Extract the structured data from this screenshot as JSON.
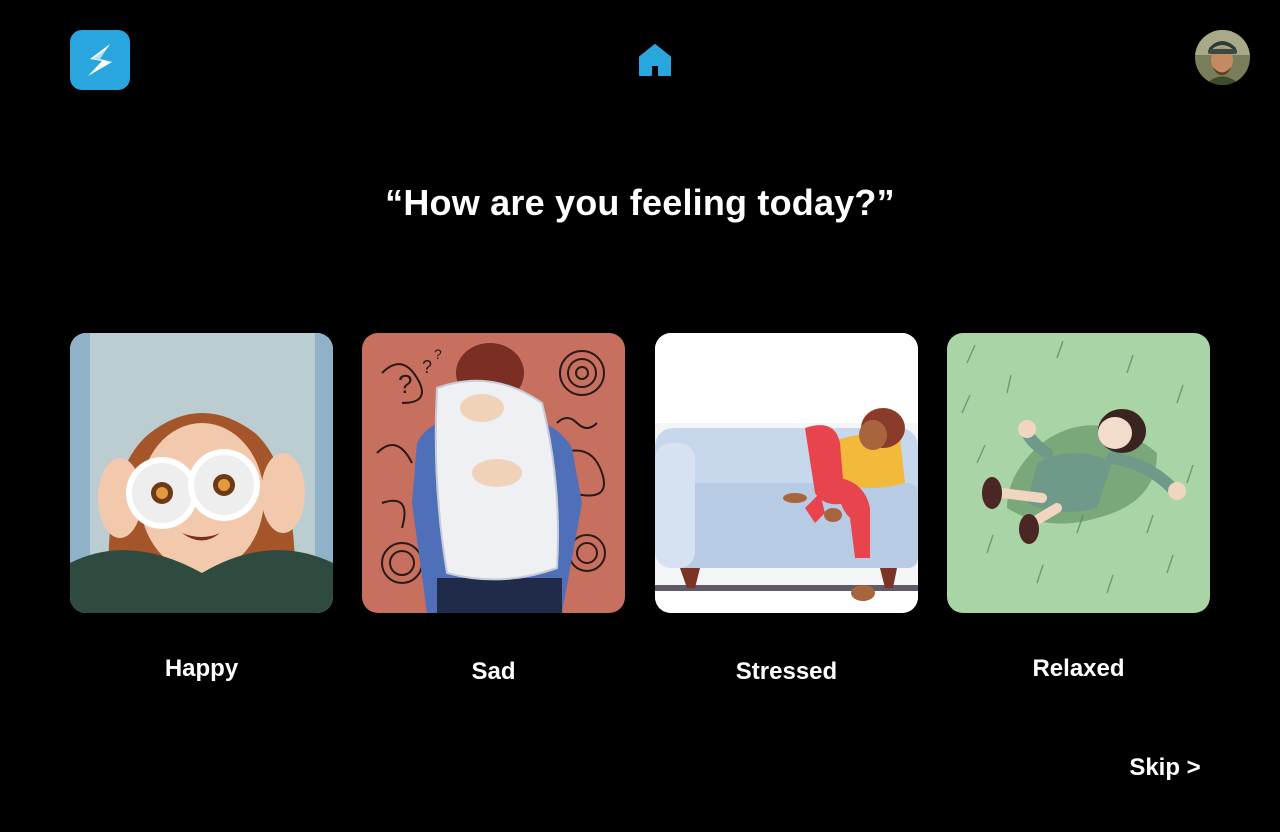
{
  "header": {
    "logo_icon": "bolt-s-logo-icon",
    "home_icon": "home-icon",
    "avatar_icon": "user-avatar",
    "accent_color": "#2aa6df"
  },
  "question": "“How are you feeling today?”",
  "moods": [
    {
      "label": "Happy",
      "image": "illustration-woman-flower-glasses"
    },
    {
      "label": "Sad",
      "image": "illustration-person-hugging-pillow"
    },
    {
      "label": "Stressed",
      "image": "illustration-woman-slumped-on-sofa"
    },
    {
      "label": "Relaxed",
      "image": "illustration-girl-lying-on-grass"
    }
  ],
  "skip_label": "Skip >"
}
